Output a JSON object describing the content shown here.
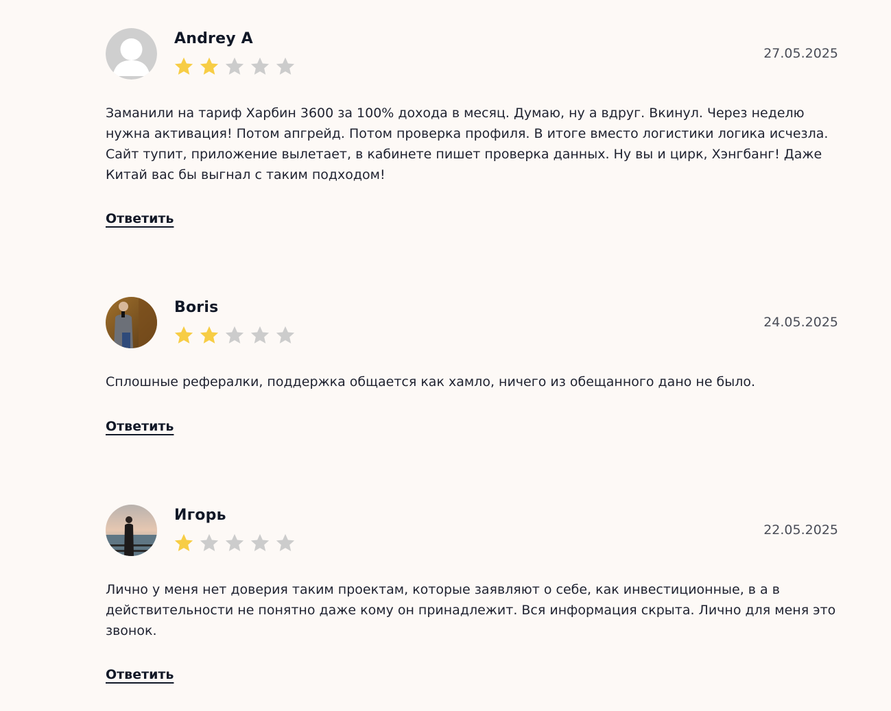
{
  "reviews": [
    {
      "author": "Andrey A",
      "date": "27.05.2025",
      "rating": 2,
      "max_rating": 5,
      "avatar": "default-user-avatar",
      "text": "Заманили на тариф Харбин 3600 за 100% дохода в месяц. Думаю, ну а вдруг. Вкинул. Через неделю нужна активация! Потом апгрейд. Потом проверка профиля. В итоге вместо логистики логика исчезла. Сайт тупит, приложение вылетает, в кабинете пишет проверка данных. Ну вы и цирк, Хэнгбанг! Даже Китай вас бы выгнал с таким подходом!",
      "reply_label": "Ответить"
    },
    {
      "author": "Boris",
      "date": "24.05.2025",
      "rating": 2,
      "max_rating": 5,
      "avatar": "user-photo-avatar",
      "text": "Сплошные рефералки, поддержка общается как хамло, ничего из обещанного дано не было.",
      "reply_label": "Ответить"
    },
    {
      "author": "Игорь",
      "date": "22.05.2025",
      "rating": 1,
      "max_rating": 5,
      "avatar": "user-photo-avatar",
      "text": "Лично у меня нет доверия таким проектам, которые заявляют о себе, как инвестиционные, в а в действительности не понятно даже кому он принадлежит. Вся информация скрыта. Лично для меня это звонок.",
      "reply_label": "Ответить"
    }
  ],
  "colors": {
    "star_filled": "#f7cd45",
    "star_empty": "#cccccc",
    "background": "#fdf9f6"
  }
}
